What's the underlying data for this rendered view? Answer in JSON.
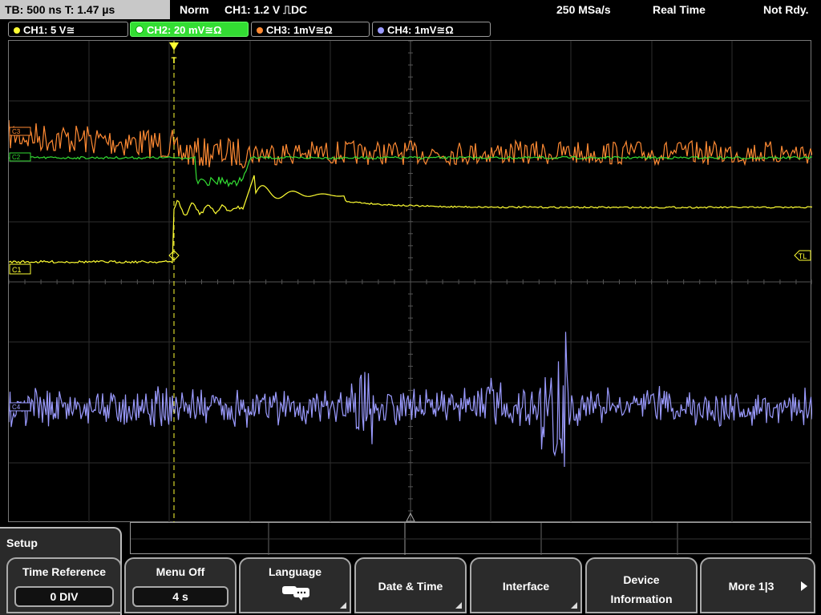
{
  "status_bar": {
    "timebase": "TB: 500 ns  T: 1.47 µs",
    "trigger_mode": "Norm",
    "trigger_info": "CH1: 1.2 V ⎍DC",
    "sample_rate": "250 MSa/s",
    "acquisition": "Real Time",
    "ready": "Not Rdy."
  },
  "channels": [
    {
      "label": "CH1: 5 V≅",
      "color": "#ffff33",
      "active": false
    },
    {
      "label": "CH2: 20 mV≅Ω",
      "color": "#33dd33",
      "active": true
    },
    {
      "label": "CH3: 1mV≅Ω",
      "color": "#ff8a33",
      "active": false
    },
    {
      "label": "CH4: 1mV≅Ω",
      "color": "#9b9bff",
      "active": false
    }
  ],
  "grid_markers": {
    "trigger_level": "TL",
    "ch1_marker": "C1",
    "ch2_marker": "C2",
    "ch3_marker": "C3",
    "ch4_marker": "C4",
    "trigger_pos_marker": "T"
  },
  "menu": {
    "title": "Setup",
    "buttons": [
      {
        "label": "Time Reference",
        "value": "0 DIV"
      },
      {
        "label": "Menu Off",
        "value": "4 s"
      },
      {
        "label": "Language",
        "value": ""
      },
      {
        "label": "Date & Time",
        "value": ""
      },
      {
        "label": "Interface",
        "value": ""
      },
      {
        "label": "Device Information",
        "value": ""
      },
      {
        "label": "More 1|3",
        "value": ""
      }
    ]
  }
}
